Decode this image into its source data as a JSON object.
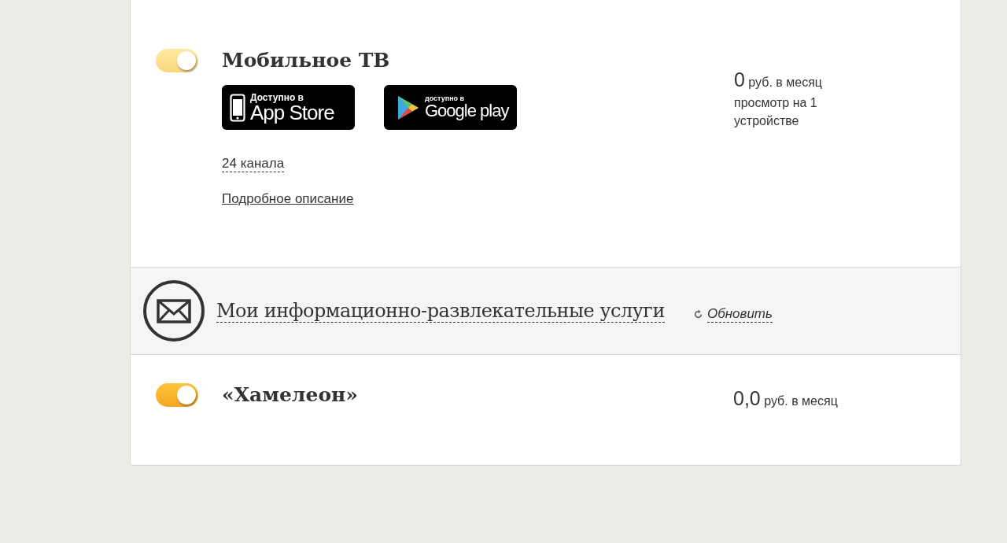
{
  "services": [
    {
      "title": "Мобильное ТВ",
      "toggle": {
        "on": true,
        "disabled": true
      },
      "stores": [
        {
          "kind": "apple",
          "caption": "Доступно в",
          "name": "App Store"
        },
        {
          "kind": "google",
          "caption": "доступно в",
          "name": "Google play"
        }
      ],
      "links": [
        {
          "kind": "dashed",
          "text": "24 канала"
        },
        {
          "kind": "solid",
          "text": "Подробное описание"
        }
      ],
      "price": {
        "amount": "0",
        "unit": "руб. в месяц",
        "note": "просмотр на 1 устройстве"
      }
    }
  ],
  "section": {
    "title": "Мои информационно-развлекательные услуги",
    "refresh": "Обновить"
  },
  "section_services": [
    {
      "title": "«Хамелеон»",
      "toggle": {
        "on": true,
        "disabled": false
      },
      "price": {
        "amount": "0,0",
        "unit": "руб. в месяц"
      }
    }
  ]
}
